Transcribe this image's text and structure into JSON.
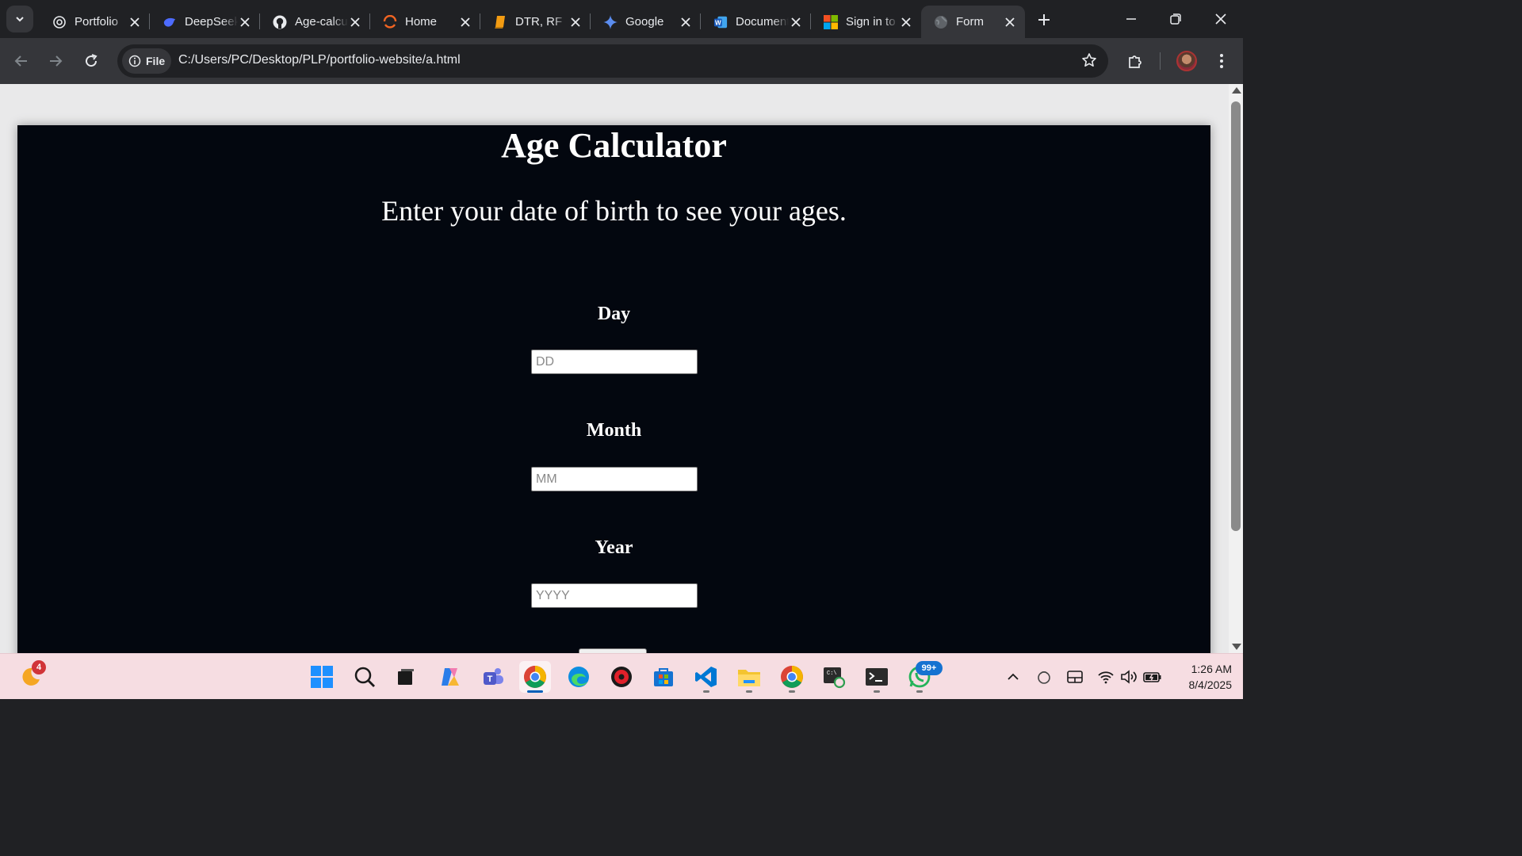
{
  "browser": {
    "tabs": [
      {
        "title": "Portfolio",
        "icon": "openai-icon"
      },
      {
        "title": "DeepSeek",
        "icon": "deepseek-icon"
      },
      {
        "title": "Age-calculator",
        "icon": "github-icon"
      },
      {
        "title": "Home",
        "icon": "home-site-icon"
      },
      {
        "title": "DTR, RF",
        "icon": "book-icon"
      },
      {
        "title": "Google",
        "icon": "gemini-icon"
      },
      {
        "title": "Document",
        "icon": "word-icon"
      },
      {
        "title": "Sign in to",
        "icon": "microsoft-icon"
      },
      {
        "title": "Form",
        "icon": "globe-icon",
        "active": true
      }
    ],
    "address": {
      "chip": "File",
      "url": "C:/Users/PC/Desktop/PLP/portfolio-website/a.html"
    }
  },
  "page": {
    "title": "Age Calculator",
    "subtitle": "Enter your date of birth to see your ages.",
    "fields": [
      {
        "label": "Day",
        "placeholder": "DD",
        "value": ""
      },
      {
        "label": "Month",
        "placeholder": "MM",
        "value": ""
      },
      {
        "label": "Year",
        "placeholder": "YYYY",
        "value": ""
      }
    ]
  },
  "taskbar": {
    "widget_badge": "4",
    "whatsapp_badge": "99+",
    "clock_time": "1:26 AM",
    "clock_date": "8/4/2025"
  },
  "colors": {
    "page_background": "#03070f",
    "viewport_background": "#e9e9ea",
    "taskbar_background": "#f6dde2",
    "browser_chrome": "#202124"
  }
}
